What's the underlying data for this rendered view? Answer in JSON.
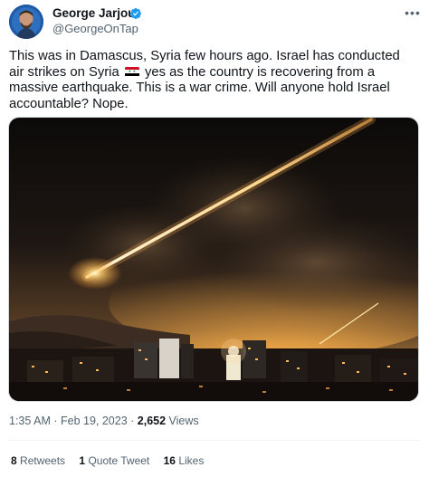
{
  "author": {
    "name": "George Jarjour",
    "handle": "@GeorgeOnTap",
    "verified": true,
    "verified_color": "#1d9bf0"
  },
  "tweet": {
    "text_before_flag": "This was in Damascus, Syria few hours ago. Israel has conducted air strikes on Syria",
    "flag_icon": "syria-flag-icon",
    "text_after_flag": "yes as the country is recovering from a massive earthquake. This is a war crime. Will anyone hold Israel accountable? Nope."
  },
  "meta": {
    "time": "1:35 AM",
    "separator": " · ",
    "date": "Feb 19, 2023",
    "views_count": "2,652",
    "views_label": " Views"
  },
  "stats": {
    "retweets_count": "8",
    "retweets_label": "Retweets",
    "quotes_count": "1",
    "quotes_label": "Quote Tweet",
    "likes_count": "16",
    "likes_label": "Likes"
  },
  "icons": {
    "more": "more-options-icon",
    "verified": "verified-badge-icon"
  }
}
